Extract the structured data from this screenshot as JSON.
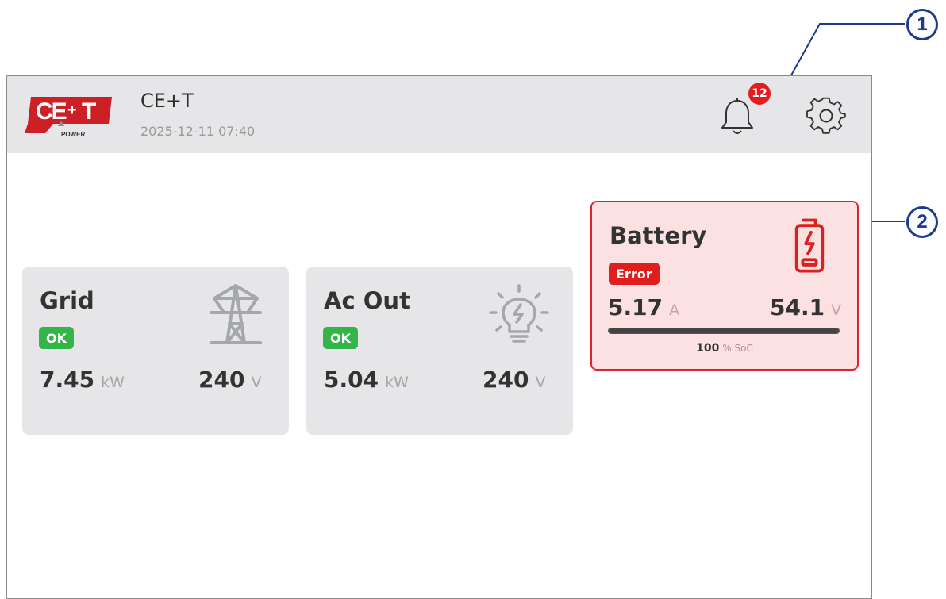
{
  "callouts": [
    "1",
    "2"
  ],
  "header": {
    "brand_name": "CE+T",
    "datetime": "2025-12-11 07:40",
    "notification_count": "12",
    "logo_text": "CE+T POWER"
  },
  "cards": [
    {
      "title": "Grid",
      "status": "OK",
      "metric1_value": "7.45",
      "metric1_unit": "kW",
      "metric2_value": "240",
      "metric2_unit": "V",
      "icon": "transmission-tower-icon"
    },
    {
      "title": "Ac Out",
      "status": "OK",
      "metric1_value": "5.04",
      "metric1_unit": "kW",
      "metric2_value": "240",
      "metric2_unit": "V",
      "icon": "light-bulb-icon"
    },
    {
      "title": "Battery",
      "status": "Error",
      "metric1_value": "5.17",
      "metric1_unit": "A",
      "metric2_value": "54.1",
      "metric2_unit": "V",
      "soc_value": "100",
      "soc_unit": "% SoC",
      "soc_fraction": 1.0,
      "icon": "battery-charging-icon"
    }
  ],
  "colors": {
    "ok": "#34b54a",
    "error": "#e01e1e",
    "callout": "#1e3a8a"
  }
}
